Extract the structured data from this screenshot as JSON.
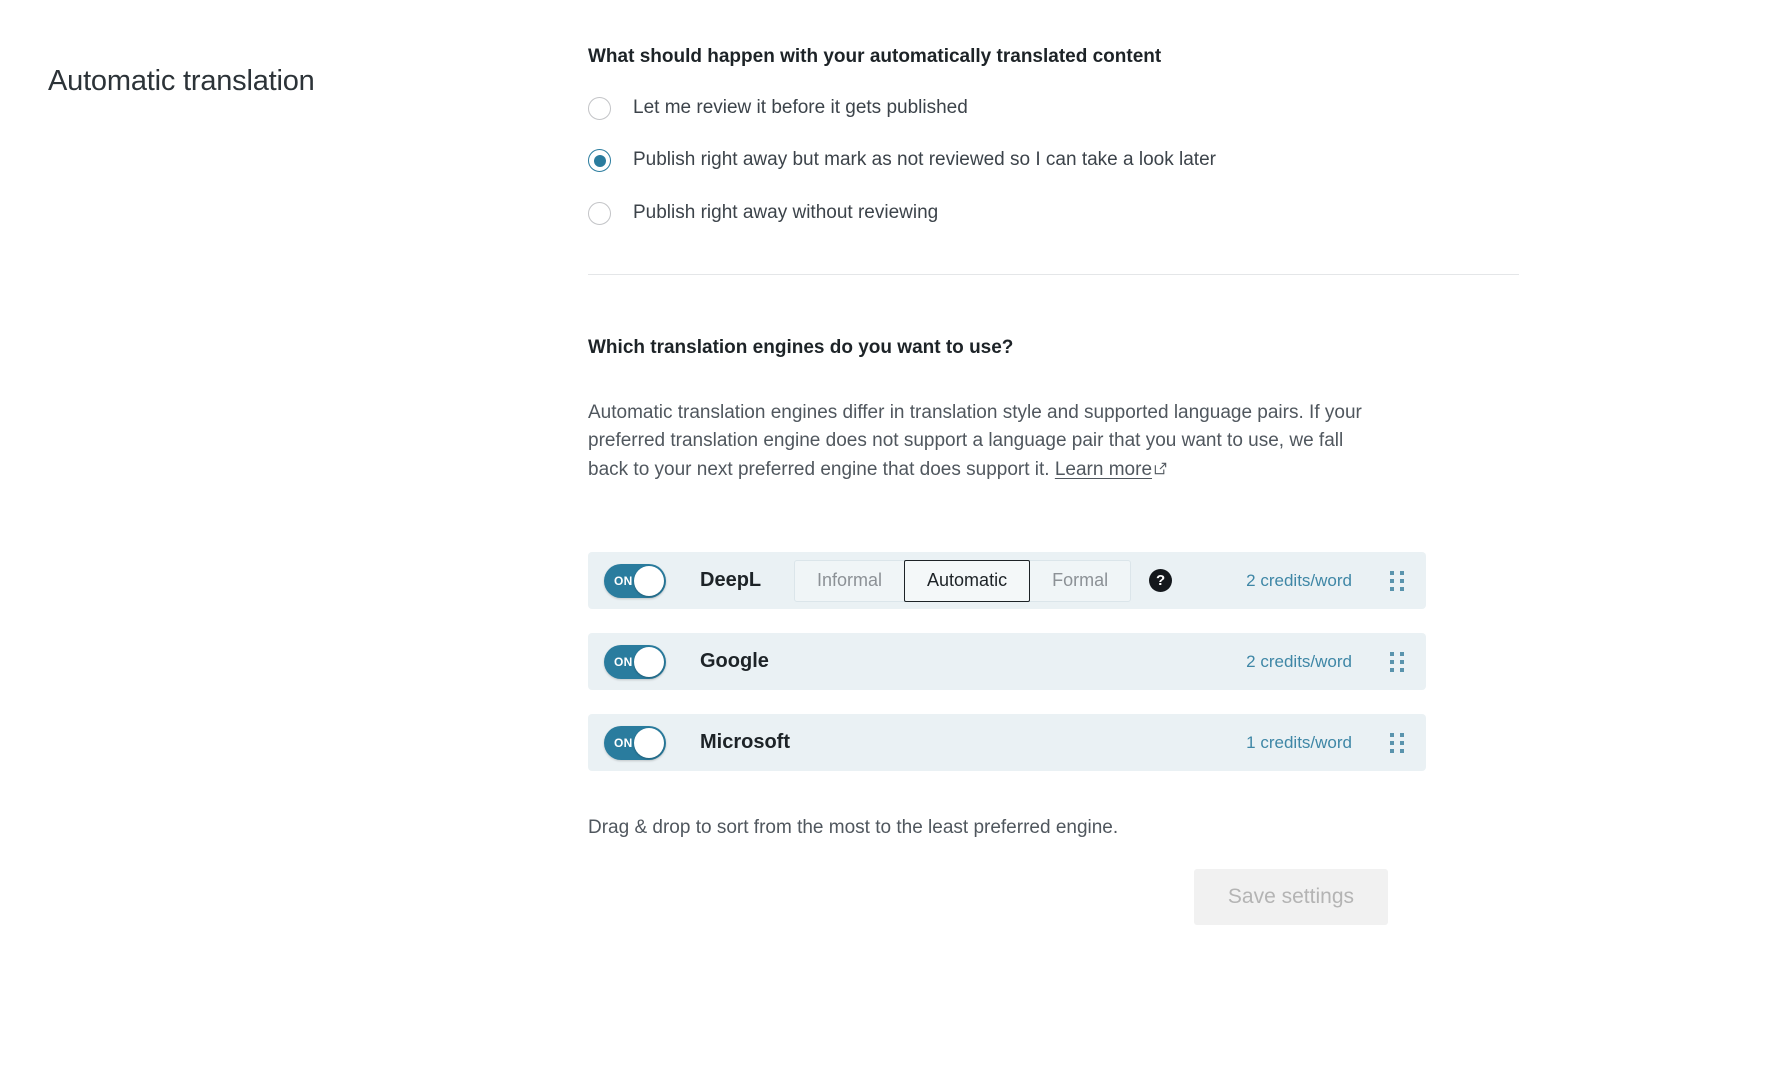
{
  "page": {
    "section_title": "Automatic translation"
  },
  "review_setting": {
    "heading": "What should happen with your automatically translated content",
    "options": [
      {
        "label": "Let me review it before it gets published",
        "selected": false
      },
      {
        "label": "Publish right away but mark as not reviewed so I can take a look later",
        "selected": true
      },
      {
        "label": "Publish right away without reviewing",
        "selected": false
      }
    ]
  },
  "engines_setting": {
    "heading": "Which translation engines do you want to use?",
    "description_before_link": "Automatic translation engines differ in translation style and supported language pairs. If your preferred translation engine does not support a language pair that you want to use, we fall back to your next preferred engine that does support it. ",
    "learn_more_label": "Learn more",
    "engines": [
      {
        "name": "DeepL",
        "toggle_label": "ON",
        "toggle_on": true,
        "credits": "2 credits/word",
        "formality": {
          "options": [
            "Informal",
            "Automatic",
            "Formal"
          ],
          "selected": "Automatic"
        },
        "has_help": true,
        "help_label": "?"
      },
      {
        "name": "Google",
        "toggle_label": "ON",
        "toggle_on": true,
        "credits": "2 credits/word",
        "has_help": false
      },
      {
        "name": "Microsoft",
        "toggle_label": "ON",
        "toggle_on": true,
        "credits": "1 credits/word",
        "has_help": false
      }
    ],
    "drag_note": "Drag & drop to sort from the most to the least preferred engine.",
    "save_label": "Save settings",
    "save_disabled": true
  },
  "colors": {
    "accent_teal": "#2a7c9e",
    "row_background": "#eaf1f4",
    "credits_text": "#3f87a6",
    "heading_text": "#1d2327",
    "body_text": "#50575e"
  }
}
